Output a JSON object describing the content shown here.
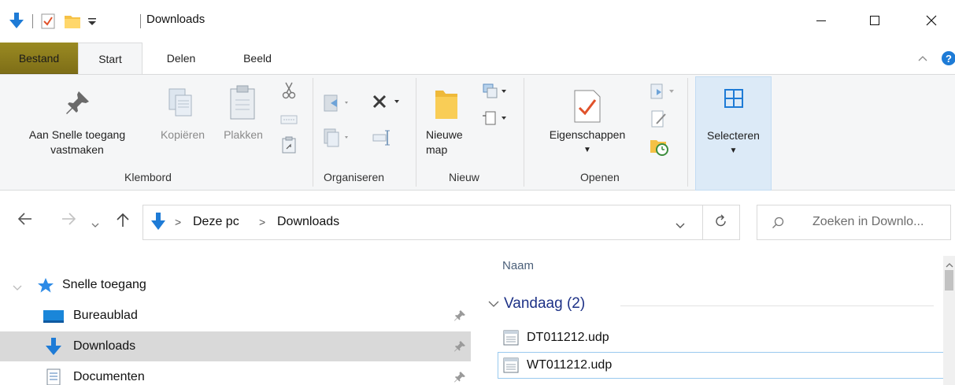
{
  "window": {
    "title": "Downloads",
    "minimize_icon": "minimize-icon",
    "maximize_icon": "maximize-icon",
    "close_icon": "close-icon"
  },
  "ribbon_tabs": [
    "Bestand",
    "Start",
    "Delen",
    "Beeld"
  ],
  "ribbon": {
    "pin_label_line1": "Aan Snelle toegang",
    "pin_label_line2": "vastmaken",
    "copy_label": "Kopiëren",
    "paste_label": "Plakken",
    "new_folder_line1": "Nieuwe",
    "new_folder_line2": "map",
    "properties_label": "Eigenschappen",
    "select_label": "Selecteren",
    "groups": {
      "clipboard": "Klembord",
      "organize": "Organiseren",
      "new": "Nieuw",
      "open": "Openen"
    }
  },
  "address": {
    "path": [
      "Deze pc",
      "Downloads"
    ],
    "separator": ">",
    "search_placeholder": "Zoeken in Downlo..."
  },
  "nav_pane": {
    "quick_access": "Snelle toegang",
    "items": [
      {
        "label": "Bureaublad",
        "icon": "desktop-icon",
        "selected": false
      },
      {
        "label": "Downloads",
        "icon": "download-arrow-icon",
        "selected": true
      },
      {
        "label": "Documenten",
        "icon": "document-icon",
        "selected": false
      }
    ]
  },
  "file_list": {
    "column_name": "Naam",
    "group": "Vandaag (2)",
    "files": [
      {
        "name": "DT011212.udp",
        "icon": "text-file-icon"
      },
      {
        "name": "WT011212.udp",
        "icon": "text-file-icon"
      }
    ]
  },
  "colors": {
    "accent_blue": "#1e7bd6",
    "file_tab": "#8b7a1c",
    "selection": "#d9d9d9",
    "group_header": "#1e3287"
  }
}
